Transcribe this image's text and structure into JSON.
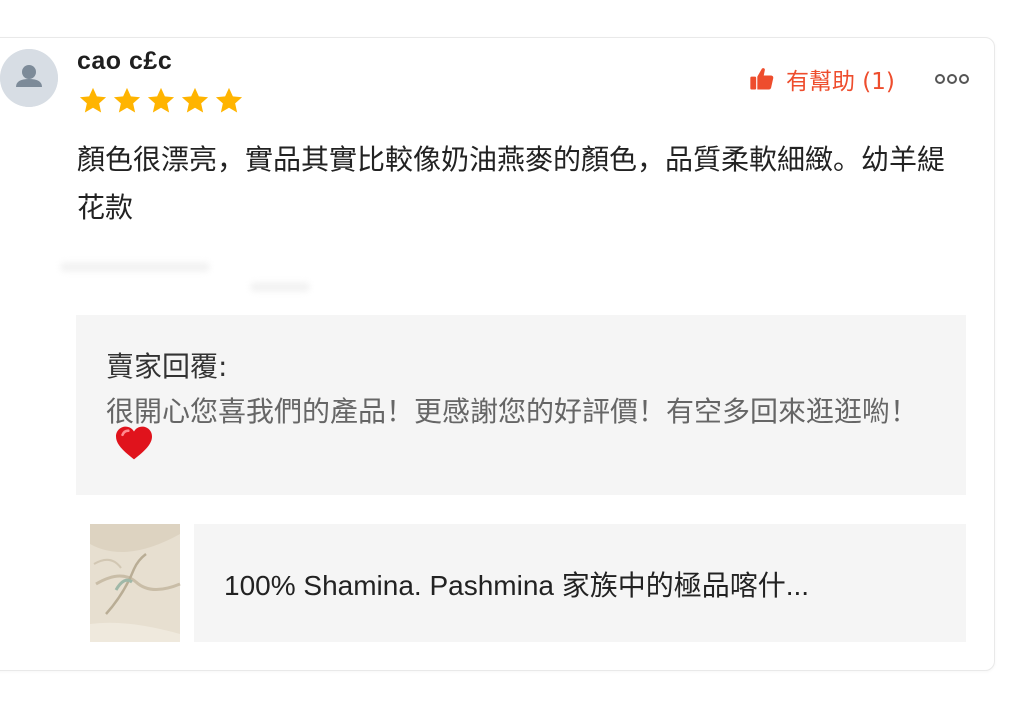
{
  "review": {
    "username": "cao  c£c",
    "rating": 5,
    "rating_max": 5,
    "helpful_label": "有幫助 (1)",
    "text": "顏色很漂亮，實品其實比較像奶油燕麥的顏色，品質柔軟細緻。幼羊緹花款"
  },
  "seller_reply": {
    "title": "賣家回覆:",
    "text": "很開心您喜我們的產品！更感謝您的好評價！有空多回來逛逛喲！"
  },
  "product": {
    "name": "100% Shamina. Pashmina 家族中的極品喀什..."
  },
  "icons": {
    "avatar": "user-avatar-icon",
    "star": "star-icon",
    "helpful": "thumbs-up-icon",
    "more": "more-options-icon",
    "heart": "heart-icon"
  },
  "colors": {
    "accent": "#ee4d2d",
    "star": "#ffb400",
    "reply_bg": "#f5f5f5",
    "avatar_bg": "#d7dde4"
  }
}
